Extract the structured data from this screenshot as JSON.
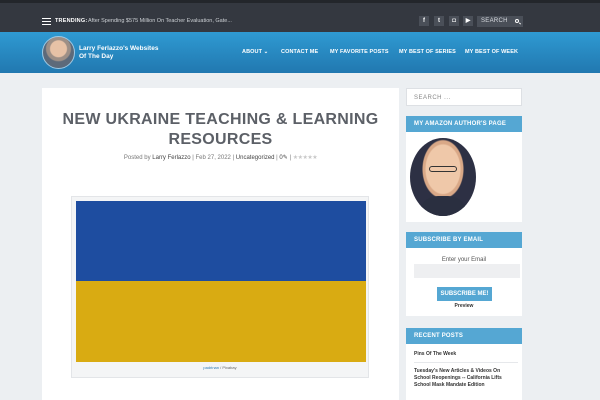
{
  "topbar": {
    "trending_label": "TRENDING:",
    "trending_text": "After Spending $575 Million On Teacher Evaluation, Gate...",
    "social": [
      {
        "icon": "facebook-icon",
        "glyph": "f"
      },
      {
        "icon": "twitter-icon",
        "glyph": "t"
      },
      {
        "icon": "instagram-icon",
        "glyph": "◘"
      },
      {
        "icon": "youtube-icon",
        "glyph": "▶"
      }
    ],
    "search_label": "SEARCH"
  },
  "header": {
    "site_title": "Larry Ferlazzo's Websites Of The Day",
    "nav": [
      {
        "label": "ABOUT ⌄"
      },
      {
        "label": "CONTACT ME"
      },
      {
        "label": "MY FAVORITE POSTS"
      },
      {
        "label": "MY BEST OF SERIES"
      },
      {
        "label": "MY BEST OF WEEK"
      }
    ]
  },
  "post": {
    "title": "NEW UKRAINE TEACHING & LEARNING RESOURCES",
    "meta_prefix": "Posted by",
    "author": "Larry Ferlazzo",
    "date": "Feb 27, 2022",
    "category": "Uncategorized",
    "comments": "0",
    "stars": "★★★★★",
    "caption_link": "padrinan",
    "caption_rest": "/ Pixabay"
  },
  "sidebar": {
    "search_placeholder": "SEARCH ...",
    "author_widget_title": "MY AMAZON AUTHOR'S PAGE",
    "subscribe_title": "SUBSCRIBE BY EMAIL",
    "subscribe_label": "Enter your Email",
    "subscribe_button": "SUBSCRIBE ME!",
    "preview_label": "Preview",
    "recent_title": "RECENT POSTS",
    "recent_posts": [
      "Pins Of The Week",
      "Tuesday's New Articles & Videos On School Reopenings -- California Lifts School Mask Mandate Edition"
    ]
  },
  "colors": {
    "header_blue": "#2a8cc6",
    "widget_blue": "#55a7d3",
    "flag_blue": "#1e4da0",
    "flag_yellow": "#d9ab12"
  }
}
